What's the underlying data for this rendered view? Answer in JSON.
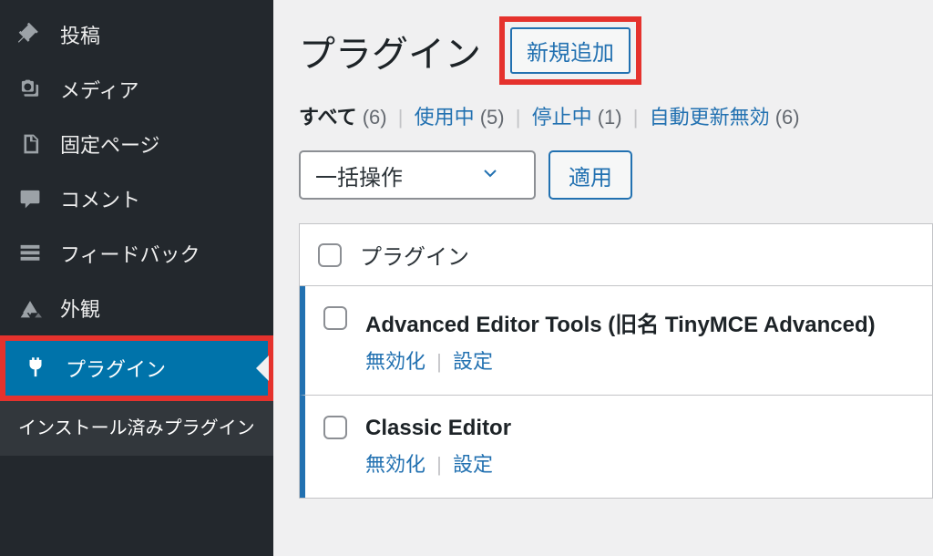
{
  "sidebar": {
    "items": [
      {
        "label": "投稿",
        "icon": "pin"
      },
      {
        "label": "メディア",
        "icon": "media"
      },
      {
        "label": "固定ページ",
        "icon": "page"
      },
      {
        "label": "コメント",
        "icon": "comment"
      },
      {
        "label": "フィードバック",
        "icon": "feedback"
      },
      {
        "label": "外観",
        "icon": "appearance"
      },
      {
        "label": "プラグイン",
        "icon": "plugin"
      }
    ],
    "submenu": {
      "installed": "インストール済みプラグイン"
    }
  },
  "header": {
    "title": "プラグイン",
    "add_new": "新規追加"
  },
  "filters": {
    "all_label": "すべて",
    "all_count": "(6)",
    "active_label": "使用中",
    "active_count": "(5)",
    "inactive_label": "停止中",
    "inactive_count": "(1)",
    "autoupdate_label": "自動更新無効",
    "autoupdate_count": "(6)"
  },
  "bulk": {
    "placeholder": "一括操作",
    "apply": "適用"
  },
  "table": {
    "head_label": "プラグイン",
    "rows": [
      {
        "name": "Advanced Editor Tools (旧名 TinyMCE Advanced)",
        "deactivate": "無効化",
        "settings": "設定"
      },
      {
        "name": "Classic Editor",
        "deactivate": "無効化",
        "settings": "設定"
      }
    ]
  }
}
